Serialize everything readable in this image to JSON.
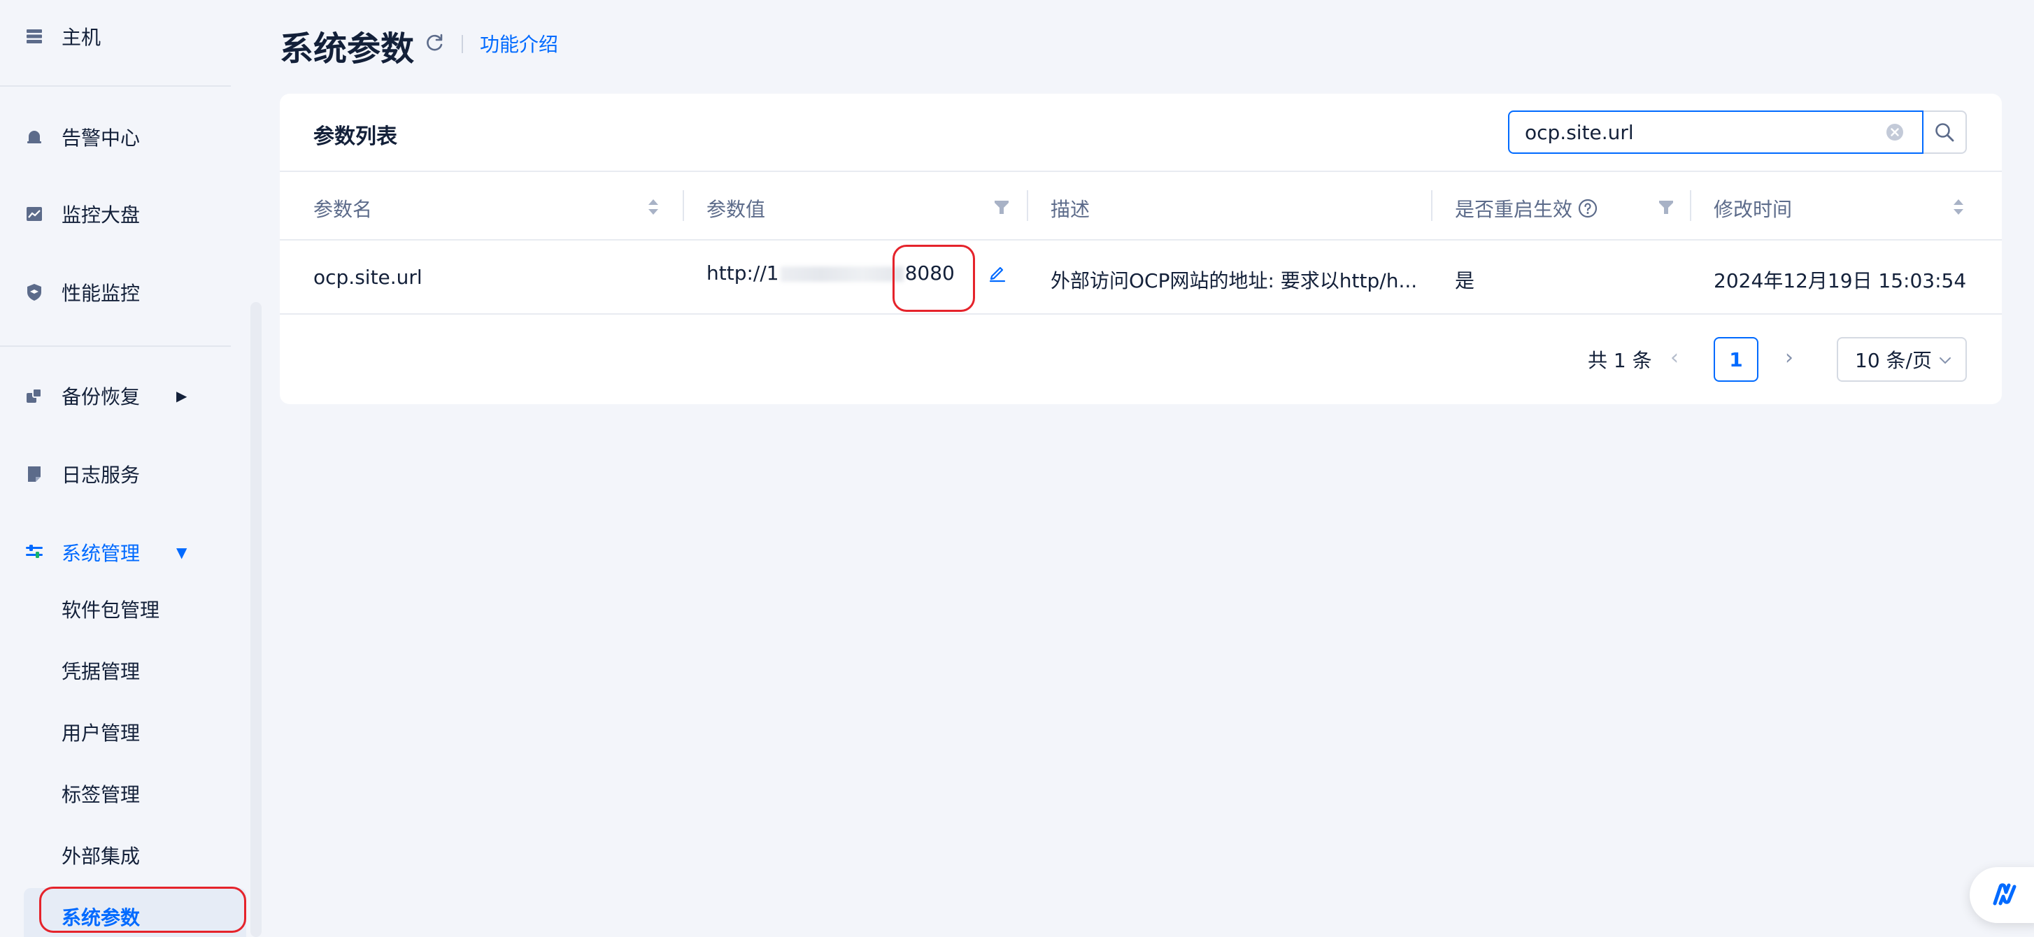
{
  "sidebar": {
    "top_item": {
      "label": "主机",
      "icon": "server-icon"
    },
    "items": [
      {
        "label": "告警中心",
        "icon": "bell-icon"
      },
      {
        "label": "监控大盘",
        "icon": "chart-icon"
      },
      {
        "label": "性能监控",
        "icon": "shield-icon"
      },
      {
        "label": "备份恢复",
        "icon": "backup-icon"
      },
      {
        "label": "日志服务",
        "icon": "log-icon"
      },
      {
        "label": "系统管理",
        "icon": "sliders-icon"
      }
    ],
    "sub_items": [
      {
        "label": "软件包管理"
      },
      {
        "label": "凭据管理"
      },
      {
        "label": "用户管理"
      },
      {
        "label": "标签管理"
      },
      {
        "label": "外部集成"
      },
      {
        "label": "系统参数"
      }
    ],
    "active_color": "#006aff"
  },
  "header": {
    "title": "系统参数",
    "intro_link": "功能介绍"
  },
  "card": {
    "title": "参数列表",
    "search": {
      "value": "ocp.site.url"
    },
    "columns": [
      "参数名",
      "参数值",
      "描述",
      "是否重启生效",
      "修改时间"
    ],
    "row": {
      "name": "ocp.site.url",
      "value_prefix": "http://1",
      "value_suffix": "8080",
      "description": "外部访问OCP网站的地址: 要求以http/h...",
      "restart": "是",
      "modified": "2024年12月19日 15:03:54"
    },
    "pagination": {
      "total": "共 1 条",
      "current": "1",
      "page_size": "10 条/页"
    }
  },
  "colors": {
    "accent": "#006aff",
    "highlight": "#e5232b",
    "background": "#f3f5fa"
  }
}
